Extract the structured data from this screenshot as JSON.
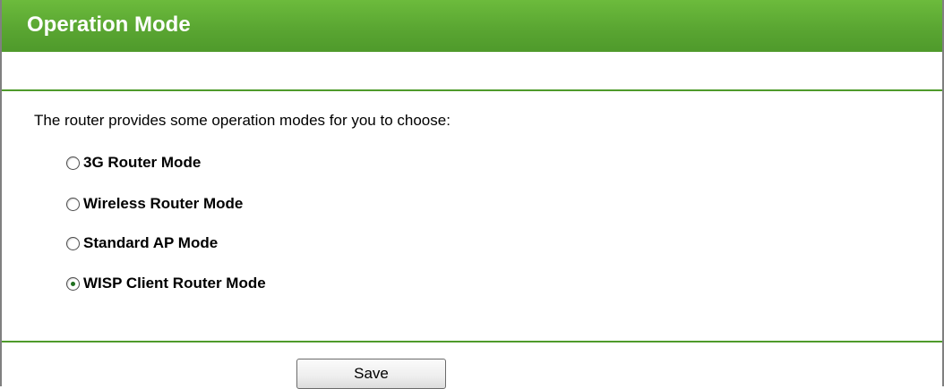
{
  "header": {
    "title": "Operation Mode"
  },
  "intro_text": "The router provides some operation modes for you to choose:",
  "modes": [
    {
      "label": "3G Router Mode",
      "checked": false
    },
    {
      "label": "Wireless Router Mode",
      "checked": false
    },
    {
      "label": "Standard AP Mode",
      "checked": false
    },
    {
      "label": "WISP Client Router Mode",
      "checked": true
    }
  ],
  "actions": {
    "save_label": "Save"
  },
  "colors": {
    "header_green": "#5aa632",
    "divider_green": "#4f9a2b"
  }
}
